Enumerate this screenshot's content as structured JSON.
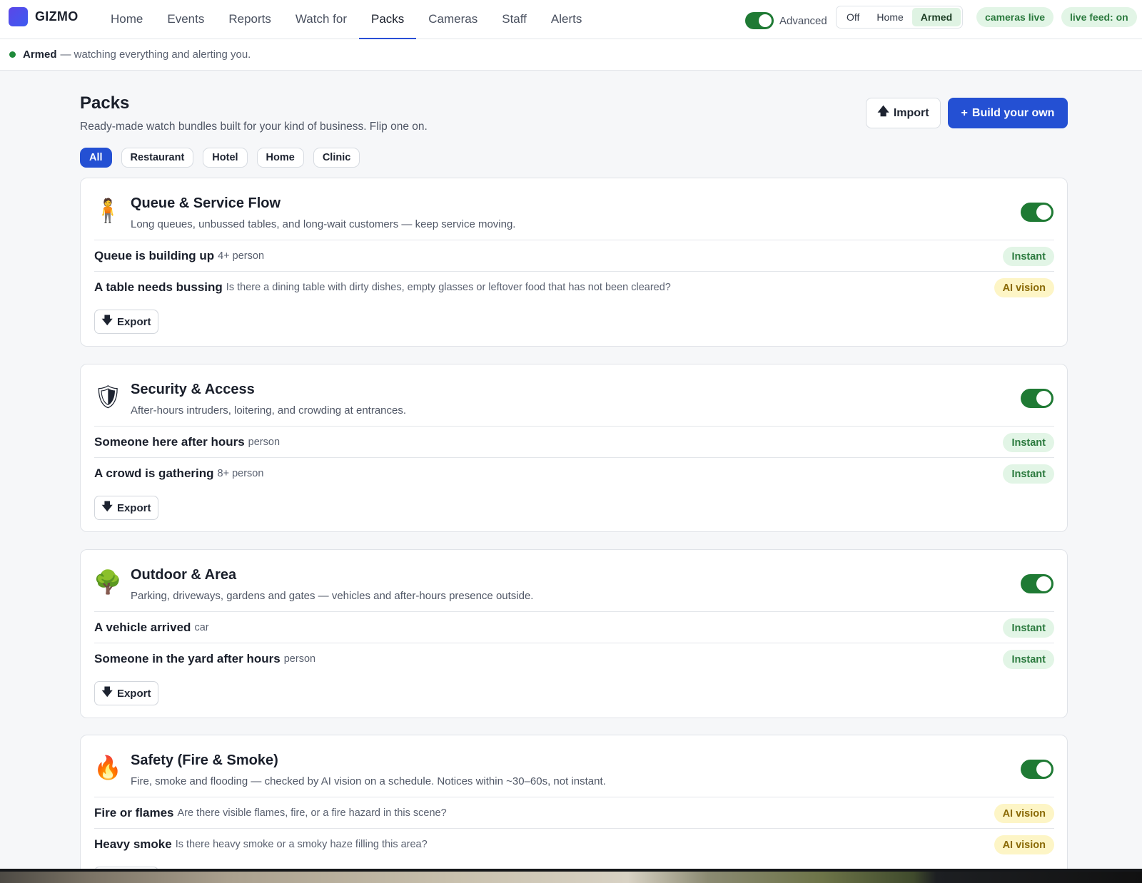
{
  "app": {
    "name": "GIZMO"
  },
  "nav": [
    "Home",
    "Events",
    "Reports",
    "Watch for",
    "Packs",
    "Cameras",
    "Staff",
    "Alerts"
  ],
  "nav_active": "Packs",
  "advanced": {
    "label": "Advanced",
    "on": true
  },
  "modes": [
    "Off",
    "Home",
    "Armed"
  ],
  "mode_active": "Armed",
  "pills": [
    "cameras live",
    "live feed: on"
  ],
  "status": {
    "state": "Armed",
    "message": "— watching everything and alerting you."
  },
  "page": {
    "title": "Packs",
    "subtitle": "Ready-made watch bundles built for your kind of business. Flip one on.",
    "import_label": "Import",
    "import_icon": "arrow-up-icon",
    "build_label": "Build your own",
    "build_icon": "plus-icon"
  },
  "filters": [
    "All",
    "Restaurant",
    "Hotel",
    "Home",
    "Clinic"
  ],
  "filter_active": "All",
  "export_label": "Export",
  "export_icon": "arrow-down-icon",
  "packs": [
    {
      "icon": "person-standing-icon",
      "emoji": "🧍",
      "title": "Queue & Service Flow",
      "description": "Long queues, unbussed tables, and long-wait customers — keep service moving.",
      "enabled": true,
      "rules": [
        {
          "name": "Queue is building up",
          "detail": "4+ person",
          "badge": "Instant"
        },
        {
          "name": "A table needs bussing",
          "detail": "Is there a dining table with dirty dishes, empty glasses or leftover food that has not been cleared?",
          "badge": "AI vision"
        }
      ]
    },
    {
      "icon": "shield-icon",
      "emoji": "🛡",
      "title": "Security & Access",
      "description": "After-hours intruders, loitering, and crowding at entrances.",
      "enabled": true,
      "rules": [
        {
          "name": "Someone here after hours",
          "detail": "person",
          "badge": "Instant"
        },
        {
          "name": "A crowd is gathering",
          "detail": "8+ person",
          "badge": "Instant"
        }
      ]
    },
    {
      "icon": "tree-icon",
      "emoji": "🌳",
      "title": "Outdoor & Area",
      "description": "Parking, driveways, gardens and gates — vehicles and after-hours presence outside.",
      "enabled": true,
      "rules": [
        {
          "name": "A vehicle arrived",
          "detail": "car",
          "badge": "Instant"
        },
        {
          "name": "Someone in the yard after hours",
          "detail": "person",
          "badge": "Instant"
        }
      ]
    },
    {
      "icon": "fire-icon",
      "emoji": "🔥",
      "title": "Safety (Fire & Smoke)",
      "description": "Fire, smoke and flooding — checked by AI vision on a schedule. Notices within ~30–60s, not instant.",
      "enabled": true,
      "rules": [
        {
          "name": "Fire or flames",
          "detail": "Are there visible flames, fire, or a fire hazard in this scene?",
          "badge": "AI vision"
        },
        {
          "name": "Heavy smoke",
          "detail": "Is there heavy smoke or a smoky haze filling this area?",
          "badge": "AI vision"
        }
      ]
    }
  ],
  "colors": {
    "accent": "#2450d3",
    "toggle_on": "#1f7a34",
    "instant_bg": "#e2f5e6",
    "ai_bg": "#fdf5c6"
  }
}
